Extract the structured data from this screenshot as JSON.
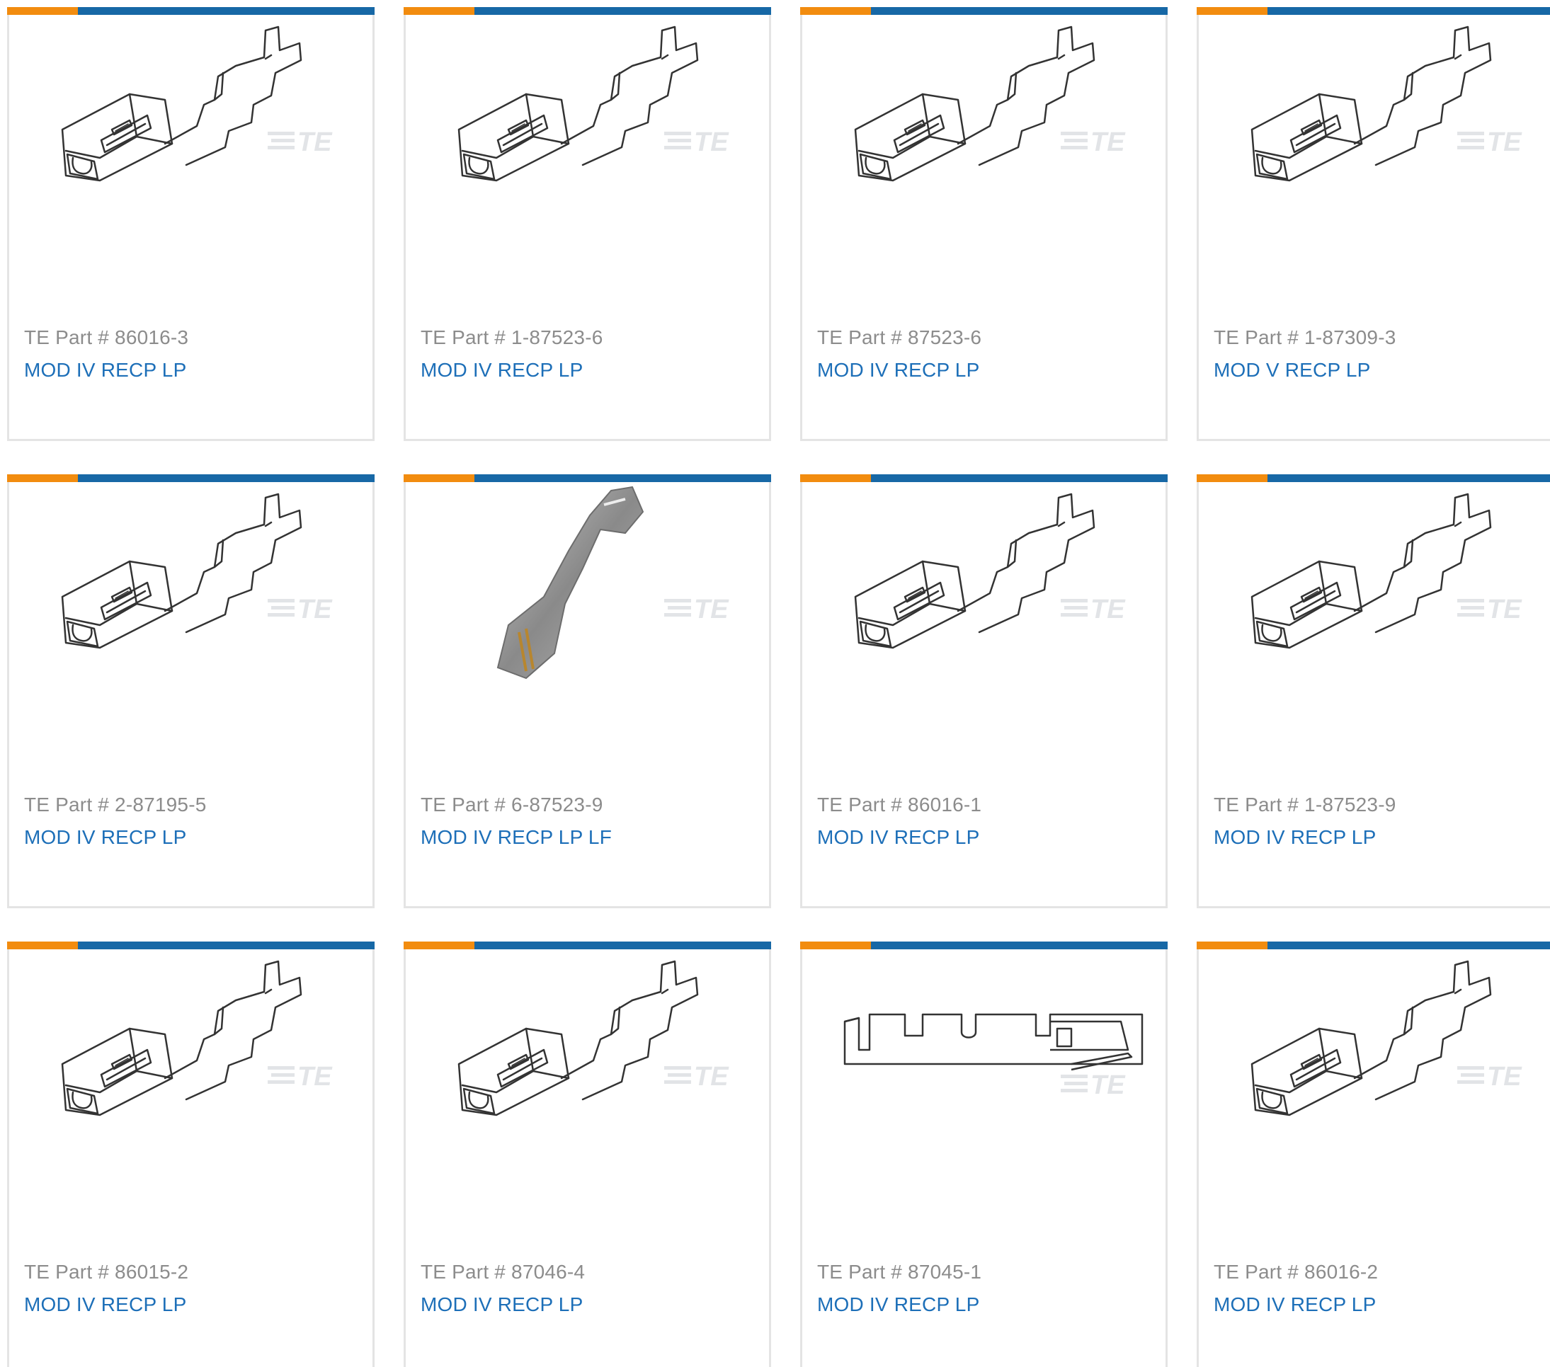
{
  "colors": {
    "accent_orange": "#f28c0f",
    "accent_blue": "#1768a6",
    "part_label": "#8c8c8c",
    "description_link": "#1d6fb8",
    "card_border": "#e4e4e4"
  },
  "logo_text": "TE",
  "products": [
    {
      "part_label": "TE Part # 86016-3",
      "description": "MOD IV RECP LP",
      "image": "receptacle-isometric-drawing"
    },
    {
      "part_label": "TE Part # 1-87523-6",
      "description": "MOD IV RECP LP",
      "image": "receptacle-isometric-drawing"
    },
    {
      "part_label": "TE Part # 87523-6",
      "description": "MOD IV RECP LP",
      "image": "receptacle-isometric-drawing"
    },
    {
      "part_label": "TE Part # 1-87309-3",
      "description": "MOD V RECP LP",
      "image": "receptacle-isometric-drawing"
    },
    {
      "part_label": "TE Part # 2-87195-5",
      "description": "MOD IV RECP LP",
      "image": "receptacle-isometric-drawing"
    },
    {
      "part_label": "TE Part # 6-87523-9",
      "description": "MOD IV RECP LP LF",
      "image": "receptacle-photo"
    },
    {
      "part_label": "TE Part # 86016-1",
      "description": "MOD IV RECP LP",
      "image": "receptacle-isometric-drawing"
    },
    {
      "part_label": "TE Part # 1-87523-9",
      "description": "MOD IV RECP LP",
      "image": "receptacle-isometric-drawing"
    },
    {
      "part_label": "TE Part # 86015-2",
      "description": "MOD IV RECP LP",
      "image": "receptacle-isometric-drawing"
    },
    {
      "part_label": "TE Part # 87046-4",
      "description": "MOD IV RECP LP",
      "image": "receptacle-isometric-drawing"
    },
    {
      "part_label": "TE Part # 87045-1",
      "description": "MOD IV RECP LP",
      "image": "receptacle-side-drawing"
    },
    {
      "part_label": "TE Part # 86016-2",
      "description": "MOD IV RECP LP",
      "image": "receptacle-isometric-drawing"
    }
  ]
}
